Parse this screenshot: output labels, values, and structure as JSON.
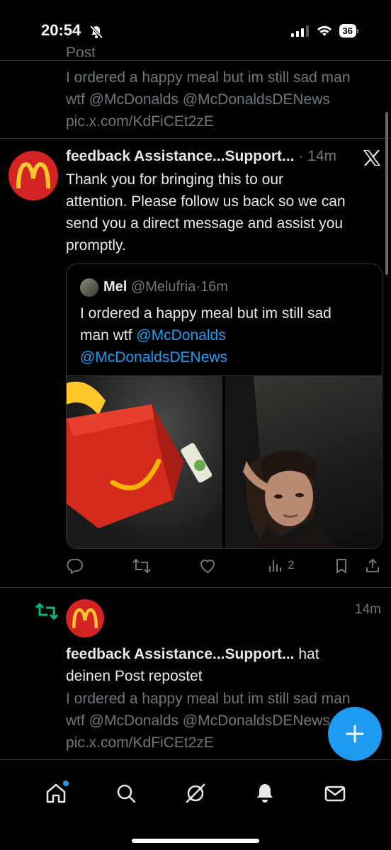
{
  "status_bar": {
    "time": "20:54",
    "battery": "36"
  },
  "top_post": {
    "cut_label": "Post",
    "lines": [
      "I ordered a happy meal but im still sad man",
      "wtf @McDonalds @McDonaldsDENews",
      "pic.x.com/KdFiCEt2zE"
    ]
  },
  "reply": {
    "author": "feedback Assistance...Support...",
    "time": "14m",
    "lines": [
      "Thank you for bringing this to our",
      "attention. Please follow us back so we can",
      "send you a direct message and assist you",
      "promptly."
    ],
    "quote": {
      "name": "Mel",
      "handle": "@Melufria",
      "time": "16m",
      "line1": "I ordered a happy meal but im still sad",
      "line2_text": "man wtf ",
      "mention1": "@McDonalds",
      "mention2": "@McDonaldsDENews"
    },
    "views_count": "2"
  },
  "repost": {
    "time": "14m",
    "author": "feedback Assistance...Support...",
    "action": " hat",
    "action_line2": "deinen Post repostet",
    "lines": [
      "I ordered a happy meal but im still sad man",
      "wtf @McDonalds @McDonaldsDENews",
      "pic.x.com/KdFiCEt2zE"
    ]
  },
  "colors": {
    "accent": "#1d9bf0",
    "repost_green": "#00ba7c",
    "mcd_red": "#d32323",
    "mcd_yellow": "#ffc72c"
  },
  "icons": [
    "bell-slash-icon",
    "signal-icon",
    "wifi-icon",
    "battery-icon",
    "x-logo-icon",
    "reply-icon",
    "repost-icon",
    "like-icon",
    "views-icon",
    "bookmark-icon",
    "share-icon",
    "compose-plus-icon",
    "home-icon",
    "search-icon",
    "grok-icon",
    "notifications-icon",
    "messages-icon"
  ]
}
